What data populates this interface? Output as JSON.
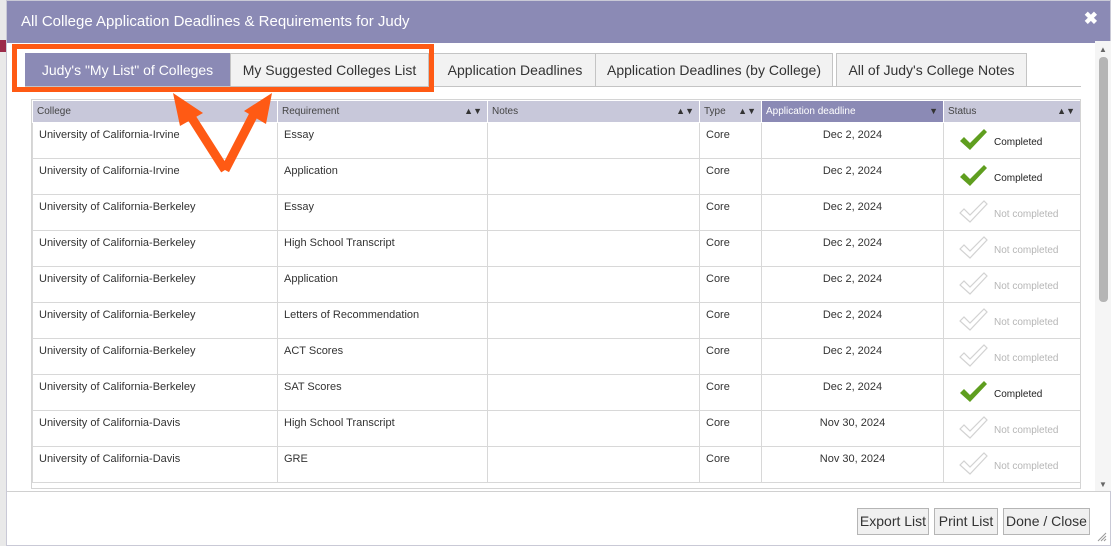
{
  "dialog": {
    "title": "All College Application Deadlines & Requirements for Judy",
    "close_label": "✖"
  },
  "tabs": [
    {
      "label": "Judy's \"My List\" of Colleges",
      "active": true
    },
    {
      "label": "My Suggested Colleges List",
      "active": false
    },
    {
      "label": "Application Deadlines",
      "active": false
    },
    {
      "label": "Application Deadlines (by College)",
      "active": false
    },
    {
      "label": "All of Judy's College Notes",
      "active": false
    }
  ],
  "table": {
    "columns": [
      {
        "label": "College",
        "sorted": false
      },
      {
        "label": "Requirement",
        "sorted": false
      },
      {
        "label": "Notes",
        "sorted": false
      },
      {
        "label": "Type",
        "sorted": false
      },
      {
        "label": "Application deadline",
        "sorted": true
      },
      {
        "label": "Status",
        "sorted": false
      }
    ],
    "rows": [
      {
        "college": "University of California-Irvine",
        "requirement": "Essay",
        "notes": "",
        "type": "Core",
        "deadline": "Dec 2, 2024",
        "status": "Completed",
        "completed": true
      },
      {
        "college": "University of California-Irvine",
        "requirement": "Application",
        "notes": "",
        "type": "Core",
        "deadline": "Dec 2, 2024",
        "status": "Completed",
        "completed": true
      },
      {
        "college": "University of California-Berkeley",
        "requirement": "Essay",
        "notes": "",
        "type": "Core",
        "deadline": "Dec 2, 2024",
        "status": "Not completed",
        "completed": false
      },
      {
        "college": "University of California-Berkeley",
        "requirement": "High School Transcript",
        "notes": "",
        "type": "Core",
        "deadline": "Dec 2, 2024",
        "status": "Not completed",
        "completed": false
      },
      {
        "college": "University of California-Berkeley",
        "requirement": "Application",
        "notes": "",
        "type": "Core",
        "deadline": "Dec 2, 2024",
        "status": "Not completed",
        "completed": false
      },
      {
        "college": "University of California-Berkeley",
        "requirement": "Letters of Recommendation",
        "notes": "",
        "type": "Core",
        "deadline": "Dec 2, 2024",
        "status": "Not completed",
        "completed": false
      },
      {
        "college": "University of California-Berkeley",
        "requirement": "ACT Scores",
        "notes": "",
        "type": "Core",
        "deadline": "Dec 2, 2024",
        "status": "Not completed",
        "completed": false
      },
      {
        "college": "University of California-Berkeley",
        "requirement": "SAT Scores",
        "notes": "",
        "type": "Core",
        "deadline": "Dec 2, 2024",
        "status": "Completed",
        "completed": true
      },
      {
        "college": "University of California-Davis",
        "requirement": "High School Transcript",
        "notes": "",
        "type": "Core",
        "deadline": "Nov 30, 2024",
        "status": "Not completed",
        "completed": false
      },
      {
        "college": "University of California-Davis",
        "requirement": "GRE",
        "notes": "",
        "type": "Core",
        "deadline": "Nov 30, 2024",
        "status": "Not completed",
        "completed": false
      }
    ]
  },
  "footer": {
    "export_label": "Export List",
    "print_label": "Print List",
    "done_label": "Done / Close"
  },
  "colors": {
    "accent": "#8b8ab5",
    "highlight": "#ff5a14",
    "check_done": "#5f9e1f",
    "check_pending": "#d2d2d2"
  }
}
